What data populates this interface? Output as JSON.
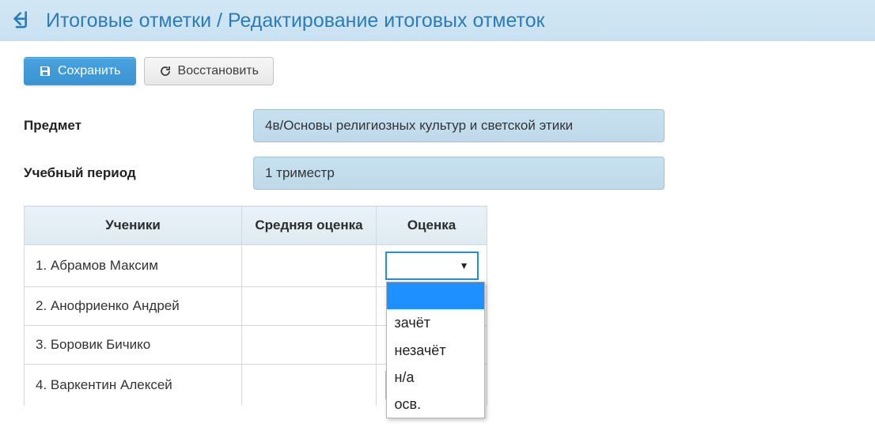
{
  "header": {
    "title": "Итоговые отметки / Редактирование итоговых отметок"
  },
  "toolbar": {
    "save_label": "Сохранить",
    "restore_label": "Восстановить"
  },
  "form": {
    "subject_label": "Предмет",
    "subject_value": "4в/Основы религиозных культур и светской этики",
    "period_label": "Учебный период",
    "period_value": "1 триместр"
  },
  "table": {
    "columns": {
      "students": "Ученики",
      "avg": "Средняя оценка",
      "grade": "Оценка"
    },
    "rows": [
      {
        "name": "1. Абрамов Максим"
      },
      {
        "name": "2. Анофриенко Андрей"
      },
      {
        "name": "3. Боровик Бичико"
      },
      {
        "name": "4. Варкентин Алексей"
      }
    ]
  },
  "dropdown": {
    "options": [
      "",
      "зачёт",
      "незачёт",
      "н/а",
      "осв."
    ]
  }
}
